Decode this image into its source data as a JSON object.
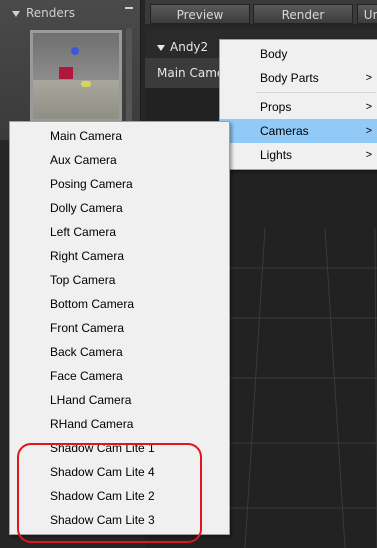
{
  "renders_panel": {
    "title": "Renders"
  },
  "tabs": [
    "Preview",
    "Render",
    "Un"
  ],
  "viewport": {
    "figure": "Andy2",
    "camera_label": "Main Came"
  },
  "main_menu": {
    "items": [
      {
        "label": "Body",
        "arrow": ""
      },
      {
        "label": "Body Parts",
        "arrow": ">"
      },
      {
        "label": "Props",
        "arrow": ">"
      },
      {
        "label": "Cameras",
        "arrow": ">"
      },
      {
        "label": "Lights",
        "arrow": ">"
      }
    ]
  },
  "camera_menu": {
    "items": [
      "Main Camera",
      "Aux Camera",
      "Posing Camera",
      "Dolly Camera",
      "Left Camera",
      "Right Camera",
      "Top Camera",
      "Bottom Camera",
      "Front Camera",
      "Back Camera",
      "Face Camera",
      "LHand Camera",
      "RHand Camera",
      "Shadow Cam Lite 1",
      "Shadow Cam Lite 4",
      "Shadow Cam Lite 2",
      "Shadow Cam Lite 3"
    ]
  },
  "colors": {
    "menu_bg": "#f0f0f0",
    "selection": "#91c9f7",
    "highlight": "#e0161c"
  }
}
